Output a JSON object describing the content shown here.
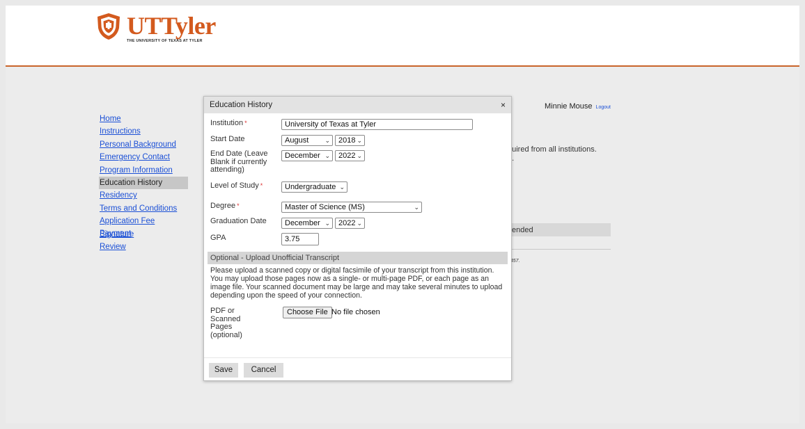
{
  "logo": {
    "wordmark": "UTTyler",
    "subtitle": "THE UNIVERSITY OF TEXAS AT TYLER",
    "brand_color": "#d35a1e",
    "icon": "shield-crest-icon"
  },
  "nav": {
    "items": [
      {
        "label": "Home",
        "active": false
      },
      {
        "label": "Instructions",
        "active": false
      },
      {
        "label": "Personal Background",
        "active": false
      },
      {
        "label": "Emergency Contact",
        "active": false
      },
      {
        "label": "Program Information",
        "active": false
      },
      {
        "label": "Education History",
        "active": true
      },
      {
        "label": "Residency",
        "active": false
      },
      {
        "label": "Terms and Conditions",
        "active": false
      },
      {
        "label": "Application Fee Payment",
        "active": false
      },
      {
        "label": "Signature",
        "active": false
      },
      {
        "label": "Review",
        "active": false
      }
    ]
  },
  "user": {
    "name": "Minnie Mouse",
    "logout_label": "Logout"
  },
  "background": {
    "text_line1": "quired from all institutions.",
    "text_line2": "d.",
    "table_header_fragment": "ended",
    "number_fragment": "7457."
  },
  "dialog": {
    "title": "Education History",
    "close_symbol": "×",
    "institution": {
      "label": "Institution",
      "required_mark": "*",
      "value": "University of Texas at Tyler"
    },
    "start_date": {
      "label": "Start Date",
      "month": "August",
      "year": "2018"
    },
    "end_date": {
      "label": "End Date (Leave Blank if currently attending)",
      "month": "December",
      "year": "2022"
    },
    "level": {
      "label": "Level of Study",
      "required_mark": "*",
      "value": "Undergraduate"
    },
    "degree": {
      "label": "Degree",
      "required_mark": "*",
      "value": "Master of Science (MS)"
    },
    "graduation": {
      "label": "Graduation Date",
      "month": "December",
      "year": "2022"
    },
    "gpa": {
      "label": "GPA",
      "value": "3.75"
    },
    "upload": {
      "section_title": "Optional - Upload Unofficial Transcript",
      "description": "Please upload a scanned copy or digital facsimile of your transcript from this institution. You may upload those pages now as a single- or multi-page PDF, or each page as an image file. Your scanned document may be large and may take several minutes to upload depending upon the speed of your connection.",
      "label": "PDF or Scanned Pages (optional)",
      "button_label": "Choose File",
      "status": "No file chosen"
    },
    "save_label": "Save",
    "cancel_label": "Cancel"
  },
  "colors": {
    "accent_rule": "#c9642a",
    "link": "#1a4fd6",
    "required": "#d33333"
  }
}
